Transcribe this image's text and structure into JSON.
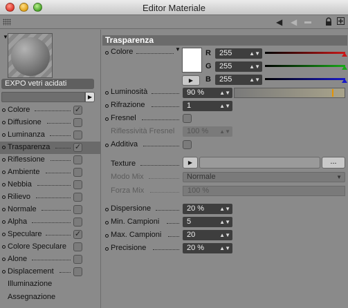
{
  "window": {
    "title": "Editor Materiale"
  },
  "toolbar": {
    "icons": [
      "back-arrow-icon",
      "forward-arrow-icon",
      "lock-icon",
      "add-window-icon"
    ]
  },
  "material": {
    "name": "EXPO vetri acidati"
  },
  "channels": [
    {
      "label": "Colore",
      "checked": true,
      "dot": true,
      "checkbox": true
    },
    {
      "label": "Diffusione",
      "checked": false,
      "dot": true,
      "checkbox": true
    },
    {
      "label": "Luminanza",
      "checked": false,
      "dot": true,
      "checkbox": true
    },
    {
      "label": "Trasparenza",
      "checked": true,
      "dot": true,
      "checkbox": true,
      "active": true
    },
    {
      "label": "Riflessione",
      "checked": false,
      "dot": true,
      "checkbox": true
    },
    {
      "label": "Ambiente",
      "checked": false,
      "dot": true,
      "checkbox": true
    },
    {
      "label": "Nebbia",
      "checked": false,
      "dot": true,
      "checkbox": true
    },
    {
      "label": "Rilievo",
      "checked": false,
      "dot": true,
      "checkbox": true
    },
    {
      "label": "Normale",
      "checked": false,
      "dot": true,
      "checkbox": true
    },
    {
      "label": "Alpha",
      "checked": false,
      "dot": true,
      "checkbox": true
    },
    {
      "label": "Speculare",
      "checked": true,
      "dot": true,
      "checkbox": true
    },
    {
      "label": "Colore Speculare",
      "checked": false,
      "dot": true,
      "checkbox": true
    },
    {
      "label": "Alone",
      "checked": false,
      "dot": true,
      "checkbox": true
    },
    {
      "label": "Displacement",
      "checked": false,
      "dot": true,
      "checkbox": true
    },
    {
      "label": "Illuminazione",
      "checked": false,
      "dot": false,
      "checkbox": false
    },
    {
      "label": "Assegnazione",
      "checked": false,
      "dot": false,
      "checkbox": false
    }
  ],
  "panel": {
    "section_title": "Trasparenza",
    "colore": {
      "label": "Colore",
      "r_label": "R",
      "r_value": "255",
      "g_label": "G",
      "g_value": "255",
      "b_label": "B",
      "b_value": "255",
      "swatch_color": "#ffffff",
      "r_color": "#c81818",
      "g_color": "#18a818",
      "b_color": "#1818c8"
    },
    "luminosita": {
      "label": "Luminosità",
      "value": "90 %",
      "fraction": 0.9
    },
    "rifrazione": {
      "label": "Rifrazione",
      "value": "1"
    },
    "fresnel": {
      "label": "Fresnel",
      "checked": false
    },
    "riflessivita_fresnel": {
      "label": "Riflessività Fresnel",
      "value": "100 %"
    },
    "additiva": {
      "label": "Additiva",
      "checked": false
    },
    "texture": {
      "label": "Texture",
      "dots": "..."
    },
    "modo_mix": {
      "label": "Modo Mix",
      "value": "Normale"
    },
    "forza_mix": {
      "label": "Forza Mix",
      "value": "100 %"
    },
    "dispersione": {
      "label": "Dispersione",
      "value": "20 %"
    },
    "min_campioni": {
      "label": "Min. Campioni",
      "value": "5"
    },
    "max_campioni": {
      "label": "Max. Campioni",
      "value": "20"
    },
    "precisione": {
      "label": "Precisione",
      "value": "20 %"
    }
  }
}
